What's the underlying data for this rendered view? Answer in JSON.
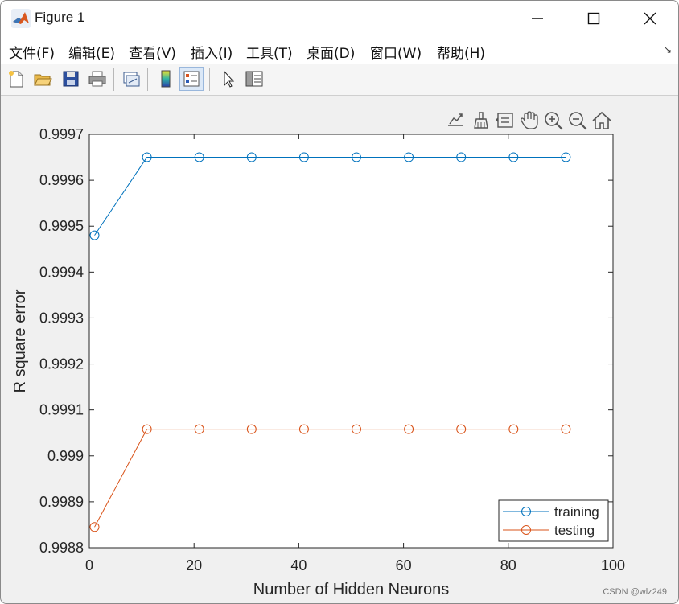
{
  "window": {
    "title": "Figure 1"
  },
  "menu": {
    "items": [
      "文件(F)",
      "编辑(E)",
      "查看(V)",
      "插入(I)",
      "工具(T)",
      "桌面(D)",
      "窗口(W)",
      "帮助(H)"
    ],
    "corner": "↘"
  },
  "toolbar": {
    "icons": [
      "new-figure-icon",
      "open-file-icon",
      "save-icon",
      "print-icon",
      "link-plot-icon",
      "colorbar-icon",
      "legend-icon",
      "pointer-icon",
      "property-inspector-icon"
    ]
  },
  "axes_toolbar": {
    "icons": [
      "export-icon",
      "brush-icon",
      "data-tips-icon",
      "pan-icon",
      "zoom-in-icon",
      "zoom-out-icon",
      "home-icon"
    ]
  },
  "chart_data": {
    "type": "line",
    "title": "",
    "xlabel": "Number of Hidden Neurons",
    "ylabel": "R square error",
    "xlim": [
      0,
      100
    ],
    "ylim": [
      0.9988,
      0.9997
    ],
    "xticks": [
      0,
      20,
      40,
      60,
      80,
      100
    ],
    "xtick_labels": [
      "0",
      "20",
      "40",
      "60",
      "80",
      "100"
    ],
    "yticks": [
      0.9988,
      0.9989,
      0.999,
      0.9991,
      0.9992,
      0.9993,
      0.9994,
      0.9995,
      0.9996,
      0.9997
    ],
    "ytick_labels": [
      "0.9988",
      "0.9989",
      "0.999",
      "0.9991",
      "0.9992",
      "0.9993",
      "0.9994",
      "0.9995",
      "0.9996",
      "0.9997"
    ],
    "grid": false,
    "legend_position": "bottom-right",
    "x": [
      1,
      11,
      21,
      31,
      41,
      51,
      61,
      71,
      81,
      91
    ],
    "series": [
      {
        "name": "training",
        "color": "#0072BD",
        "marker": "circle",
        "values": [
          0.99948,
          0.99965,
          0.99965,
          0.99965,
          0.99965,
          0.99965,
          0.99965,
          0.99965,
          0.99965,
          0.99965
        ]
      },
      {
        "name": "testing",
        "color": "#D95319",
        "marker": "circle",
        "values": [
          0.998845,
          0.999058,
          0.999058,
          0.999058,
          0.999058,
          0.999058,
          0.999058,
          0.999058,
          0.999058,
          0.999058
        ]
      }
    ]
  },
  "watermark": "CSDN @wlz249"
}
